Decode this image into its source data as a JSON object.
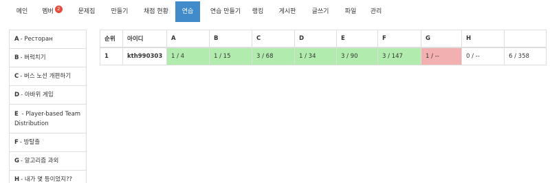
{
  "nav": {
    "items": [
      {
        "label": "메인"
      },
      {
        "label": "멤버",
        "badge": "2"
      },
      {
        "label": "문제집"
      },
      {
        "label": "만들기"
      },
      {
        "label": "채점 현황"
      },
      {
        "label": "연습",
        "active": true
      },
      {
        "label": "연습 만들기"
      },
      {
        "label": "랭킹"
      },
      {
        "label": "게시판"
      },
      {
        "label": "글쓰기"
      },
      {
        "label": "파일"
      },
      {
        "label": "관리"
      }
    ]
  },
  "sidebar": {
    "items": [
      {
        "letter": "A",
        "title": "- Ресторан"
      },
      {
        "letter": "B",
        "title": "- 버럭치기"
      },
      {
        "letter": "C",
        "title": "- 버스 노선 개편하기"
      },
      {
        "letter": "D",
        "title": "- 아바위 게임"
      },
      {
        "letter": "E",
        "title": "- Player-based Team Distribution"
      },
      {
        "letter": "F",
        "title": "- 방탈출"
      },
      {
        "letter": "G",
        "title": "- 알고리즘 과외"
      },
      {
        "letter": "H",
        "title": "- 내가 몇 등이었지??"
      }
    ]
  },
  "table": {
    "headers": [
      "순위",
      "아이디",
      "A",
      "B",
      "C",
      "D",
      "E",
      "F",
      "G",
      "H",
      ""
    ],
    "rows": [
      {
        "rank": "1",
        "user": "kth990303",
        "cells": [
          {
            "text": "1 / 4",
            "status": "ok"
          },
          {
            "text": "1 / 15",
            "status": "ok"
          },
          {
            "text": "3 / 68",
            "status": "ok"
          },
          {
            "text": "1 / 34",
            "status": "ok"
          },
          {
            "text": "3 / 90",
            "status": "ok"
          },
          {
            "text": "3 / 147",
            "status": "ok"
          },
          {
            "text": "1 / --",
            "status": "wrong"
          },
          {
            "text": "0 / --",
            "status": "none"
          }
        ],
        "total": "6 / 358"
      }
    ]
  },
  "colors": {
    "accent": "#428bca",
    "solved": "#b1ebad",
    "failed": "#f2b0b0",
    "badge": "#e74c3c"
  }
}
